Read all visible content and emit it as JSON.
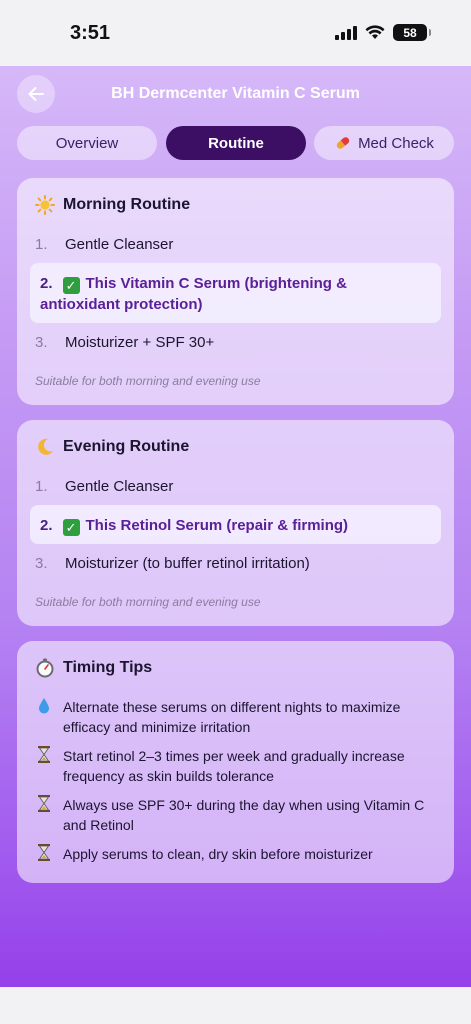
{
  "status": {
    "time": "3:51",
    "battery": "58"
  },
  "header": {
    "title": "BH Dermcenter Vitamin C Serum"
  },
  "tabs": [
    {
      "label": "Overview",
      "active": false
    },
    {
      "label": "Routine",
      "active": true
    },
    {
      "label": "Med Check",
      "active": false,
      "icon": "pill-icon"
    }
  ],
  "morning": {
    "title": "Morning Routine",
    "icon": "sun-icon",
    "steps": [
      {
        "num": "1.",
        "text": "Gentle Cleanser"
      },
      {
        "num": "2.",
        "text": "This Vitamin C Serum (brightening & antioxidant protection)",
        "highlight": true
      },
      {
        "num": "3.",
        "text": "Moisturizer + SPF 30+"
      }
    ],
    "note": "Suitable for both morning and evening use"
  },
  "evening": {
    "title": "Evening Routine",
    "icon": "moon-icon",
    "steps": [
      {
        "num": "1.",
        "text": "Gentle Cleanser"
      },
      {
        "num": "2.",
        "text": "This Retinol Serum (repair & firming)",
        "highlight": true
      },
      {
        "num": "3.",
        "text": "Moisturizer (to buffer retinol irritation)"
      }
    ],
    "note": "Suitable for both morning and evening use"
  },
  "timing": {
    "title": "Timing Tips",
    "icon": "stopwatch-icon",
    "tips": [
      {
        "icon": "droplet-icon",
        "text": "Alternate these serums on different nights to maximize efficacy and minimize irritation"
      },
      {
        "icon": "hourglass-icon",
        "text": "Start retinol 2–3 times per week and gradually increase frequency as skin builds tolerance"
      },
      {
        "icon": "hourglass-icon",
        "text": "Always use SPF 30+ during the day when using Vitamin C and Retinol"
      },
      {
        "icon": "hourglass-icon",
        "text": "Apply serums to clean, dry skin before moisturizer"
      }
    ]
  },
  "colors": {
    "active_tab": "#3c0f64",
    "highlight_text": "#5a2098",
    "check": "#2e9e3e"
  }
}
